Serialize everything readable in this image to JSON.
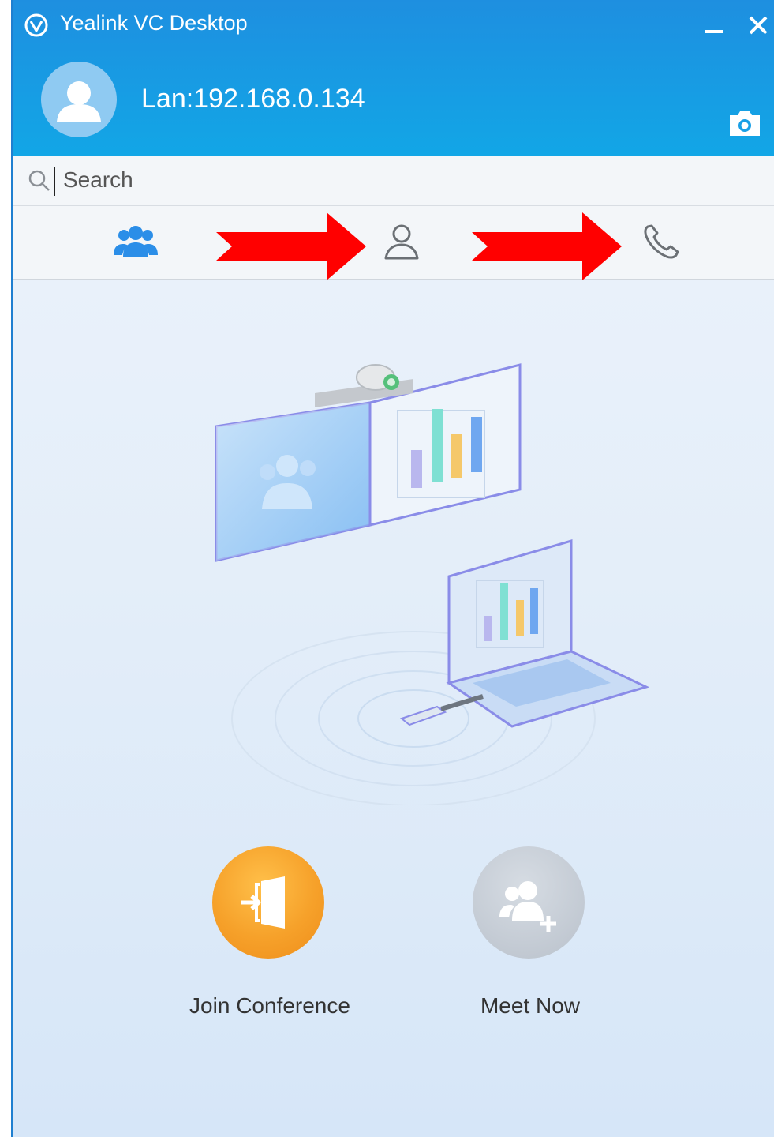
{
  "app": {
    "title": "Yealink VC Desktop",
    "account_label": "Lan:192.168.0.134"
  },
  "search": {
    "placeholder": "Search",
    "value": ""
  },
  "tabs": [
    {
      "name": "conference",
      "icon": "group-icon",
      "active": true
    },
    {
      "name": "contacts",
      "icon": "person-icon",
      "active": false
    },
    {
      "name": "calls",
      "icon": "phone-icon",
      "active": false
    }
  ],
  "actions": {
    "join_label": "Join Conference",
    "meet_label": "Meet Now"
  },
  "colors": {
    "header": "#1e8fe0",
    "accent": "#2b8ee8",
    "annotation_arrow": "#ff0000",
    "join_button": "#f6a12a",
    "meet_button": "#c5ccd5"
  }
}
